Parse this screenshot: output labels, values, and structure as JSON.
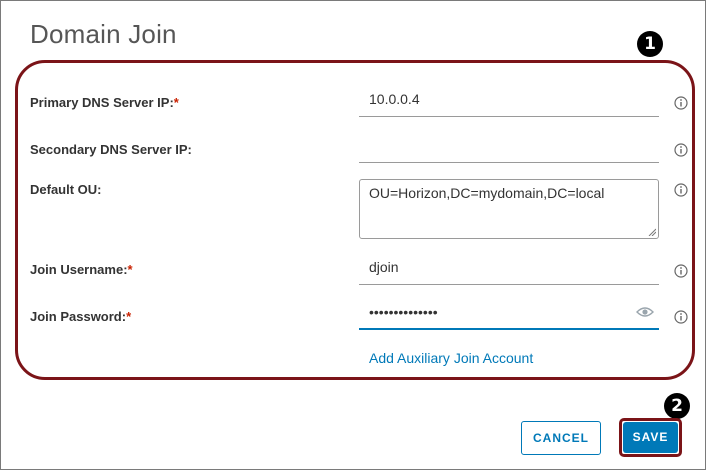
{
  "dialog": {
    "title": "Domain Join"
  },
  "callouts": {
    "first": "1",
    "second": "2"
  },
  "fields": {
    "primary_dns": {
      "label": "Primary DNS Server IP:",
      "required_mark": "*",
      "value": "10.0.0.4"
    },
    "secondary_dns": {
      "label": "Secondary DNS Server IP:",
      "value": ""
    },
    "default_ou": {
      "label": "Default OU:",
      "value": "OU=Horizon,DC=mydomain,DC=local"
    },
    "join_username": {
      "label": "Join Username:",
      "required_mark": "*",
      "value": "djoin"
    },
    "join_password": {
      "label": "Join Password:",
      "required_mark": "*",
      "value": "••••••••••••••"
    }
  },
  "links": {
    "add_auxiliary": "Add Auxiliary Join Account"
  },
  "buttons": {
    "cancel": "CANCEL",
    "save": "SAVE"
  },
  "icons": {
    "info": "info-icon",
    "password_visibility": "eye-icon"
  },
  "colors": {
    "accent": "#0079b8",
    "required": "#c92100",
    "highlight": "#7b1418",
    "callout": "#000000"
  }
}
